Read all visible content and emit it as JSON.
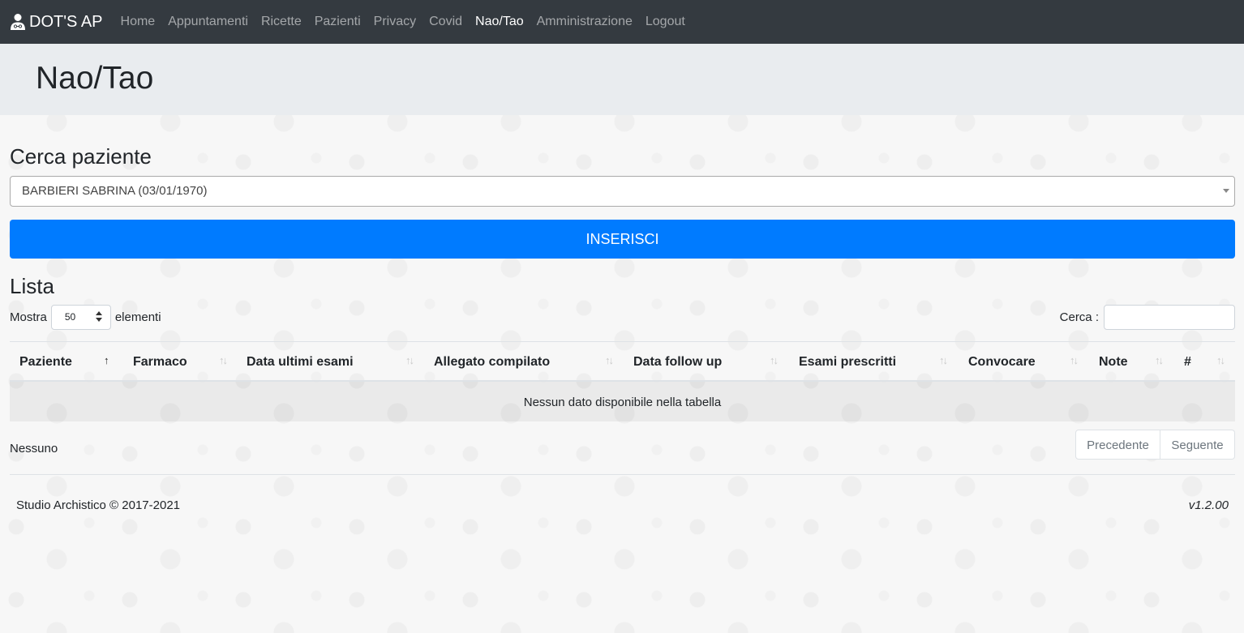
{
  "navbar": {
    "brand": "DOT'S AP",
    "brand_icon": "doctor-icon",
    "items": [
      {
        "label": "Home",
        "active": false
      },
      {
        "label": "Appuntamenti",
        "active": false
      },
      {
        "label": "Ricette",
        "active": false
      },
      {
        "label": "Pazienti",
        "active": false
      },
      {
        "label": "Privacy",
        "active": false
      },
      {
        "label": "Covid",
        "active": false
      },
      {
        "label": "Nao/Tao",
        "active": true
      },
      {
        "label": "Amministrazione",
        "active": false
      },
      {
        "label": "Logout",
        "active": false
      }
    ]
  },
  "page": {
    "title": "Nao/Tao"
  },
  "patient_search": {
    "heading": "Cerca paziente",
    "selected": "BARBIERI SABRINA (03/01/1970)",
    "insert_button": "INSERISCI"
  },
  "list": {
    "heading": "Lista",
    "show_label": "Mostra",
    "page_length": "50",
    "elements_label": "elementi",
    "search_label": "Cerca :",
    "search_value": "",
    "columns": [
      {
        "label": "Paziente",
        "sort": "asc"
      },
      {
        "label": "Farmaco",
        "sort": "none"
      },
      {
        "label": "Data ultimi esami",
        "sort": "none"
      },
      {
        "label": "Allegato compilato",
        "sort": "none"
      },
      {
        "label": "Data follow up",
        "sort": "none"
      },
      {
        "label": "Esami prescritti",
        "sort": "none"
      },
      {
        "label": "Convocare",
        "sort": "none"
      },
      {
        "label": "Note",
        "sort": "none"
      },
      {
        "label": "#",
        "sort": "none"
      }
    ],
    "empty_message": "Nessun dato disponibile nella tabella",
    "info": "Nessuno",
    "prev_label": "Precedente",
    "next_label": "Seguente"
  },
  "footer": {
    "copyright": "Studio Archistico © 2017-2021",
    "version": "v1.2.00"
  },
  "colors": {
    "navbar_bg": "#343a40",
    "primary": "#007bff",
    "jumbotron_bg": "#e9ecef"
  }
}
